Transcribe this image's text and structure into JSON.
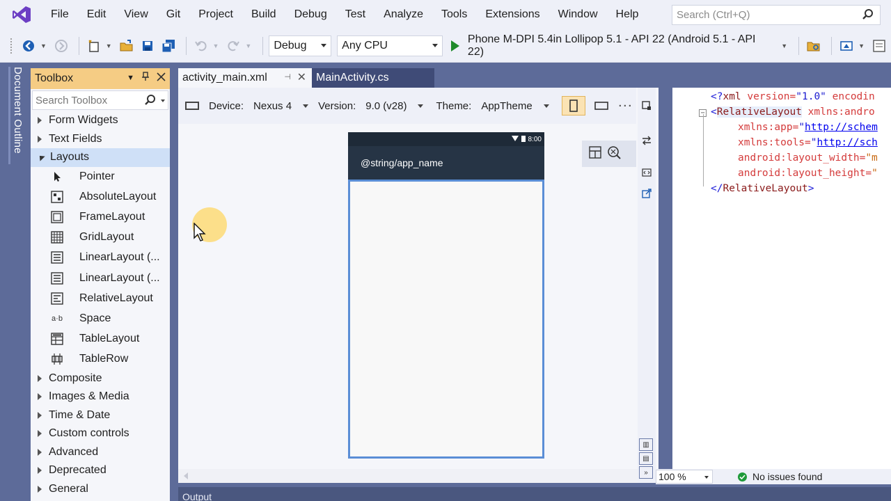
{
  "menu": [
    "File",
    "Edit",
    "View",
    "Git",
    "Project",
    "Build",
    "Debug",
    "Test",
    "Analyze",
    "Tools",
    "Extensions",
    "Window",
    "Help"
  ],
  "search": {
    "placeholder": "Search (Ctrl+Q)"
  },
  "toolbar": {
    "config": "Debug",
    "platform": "Any CPU",
    "run_target": "Phone M-DPI 5.4in Lollipop 5.1 - API 22 (Android 5.1 - API 22)"
  },
  "doc_outline_label": "Document Outline",
  "toolbox": {
    "title": "Toolbox",
    "search_placeholder": "Search Toolbox",
    "categories_before": [
      "Form Widgets",
      "Text Fields"
    ],
    "open_category": "Layouts",
    "tools": [
      {
        "label": "Pointer",
        "icon": "pointer-icon"
      },
      {
        "label": "AbsoluteLayout",
        "icon": "absolute-layout-icon"
      },
      {
        "label": "FrameLayout",
        "icon": "frame-layout-icon"
      },
      {
        "label": "GridLayout",
        "icon": "grid-layout-icon"
      },
      {
        "label": "LinearLayout (...",
        "icon": "linear-layout-icon"
      },
      {
        "label": "LinearLayout (...",
        "icon": "linear-layout-icon"
      },
      {
        "label": "RelativeLayout",
        "icon": "relative-layout-icon"
      },
      {
        "label": "Space",
        "icon": "space-icon",
        "glyph": "a·b"
      },
      {
        "label": "TableLayout",
        "icon": "table-layout-icon"
      },
      {
        "label": "TableRow",
        "icon": "table-row-icon"
      }
    ],
    "categories_after": [
      "Composite",
      "Images & Media",
      "Time & Date",
      "Custom controls",
      "Advanced",
      "Deprecated",
      "General"
    ]
  },
  "tabs": {
    "active": "activity_main.xml",
    "inactive": "MainActivity.cs"
  },
  "designer": {
    "device_label": "Device:",
    "device_value": "Nexus 4",
    "version_label": "Version:",
    "version_value": "9.0 (v28)",
    "theme_label": "Theme:",
    "theme_value": "AppTheme",
    "status_time": "8:00",
    "app_name": "@string/app_name"
  },
  "xml": {
    "l1": {
      "open": "<?",
      "tag": "xml",
      "attr1": " version=",
      "val1": "\"1.0\"",
      "rest": " encodin"
    },
    "l2": {
      "open": "<",
      "tag": "RelativeLayout",
      "attr": " xmlns:andro"
    },
    "l3": {
      "attr": "xmlns:app=",
      "link": "http://schem"
    },
    "l4": {
      "attr": "xmlns:tools=",
      "link": "http://sch"
    },
    "l5": {
      "attr": "android:layout_width=",
      "val": "\"m"
    },
    "l6": {
      "attr": "android:layout_height=",
      "val": "\""
    },
    "l7": {
      "open": "</",
      "tag": "RelativeLayout",
      "close": ">"
    }
  },
  "status": {
    "zoom": "100 %",
    "issues": "No issues found"
  },
  "output_label": "Output"
}
